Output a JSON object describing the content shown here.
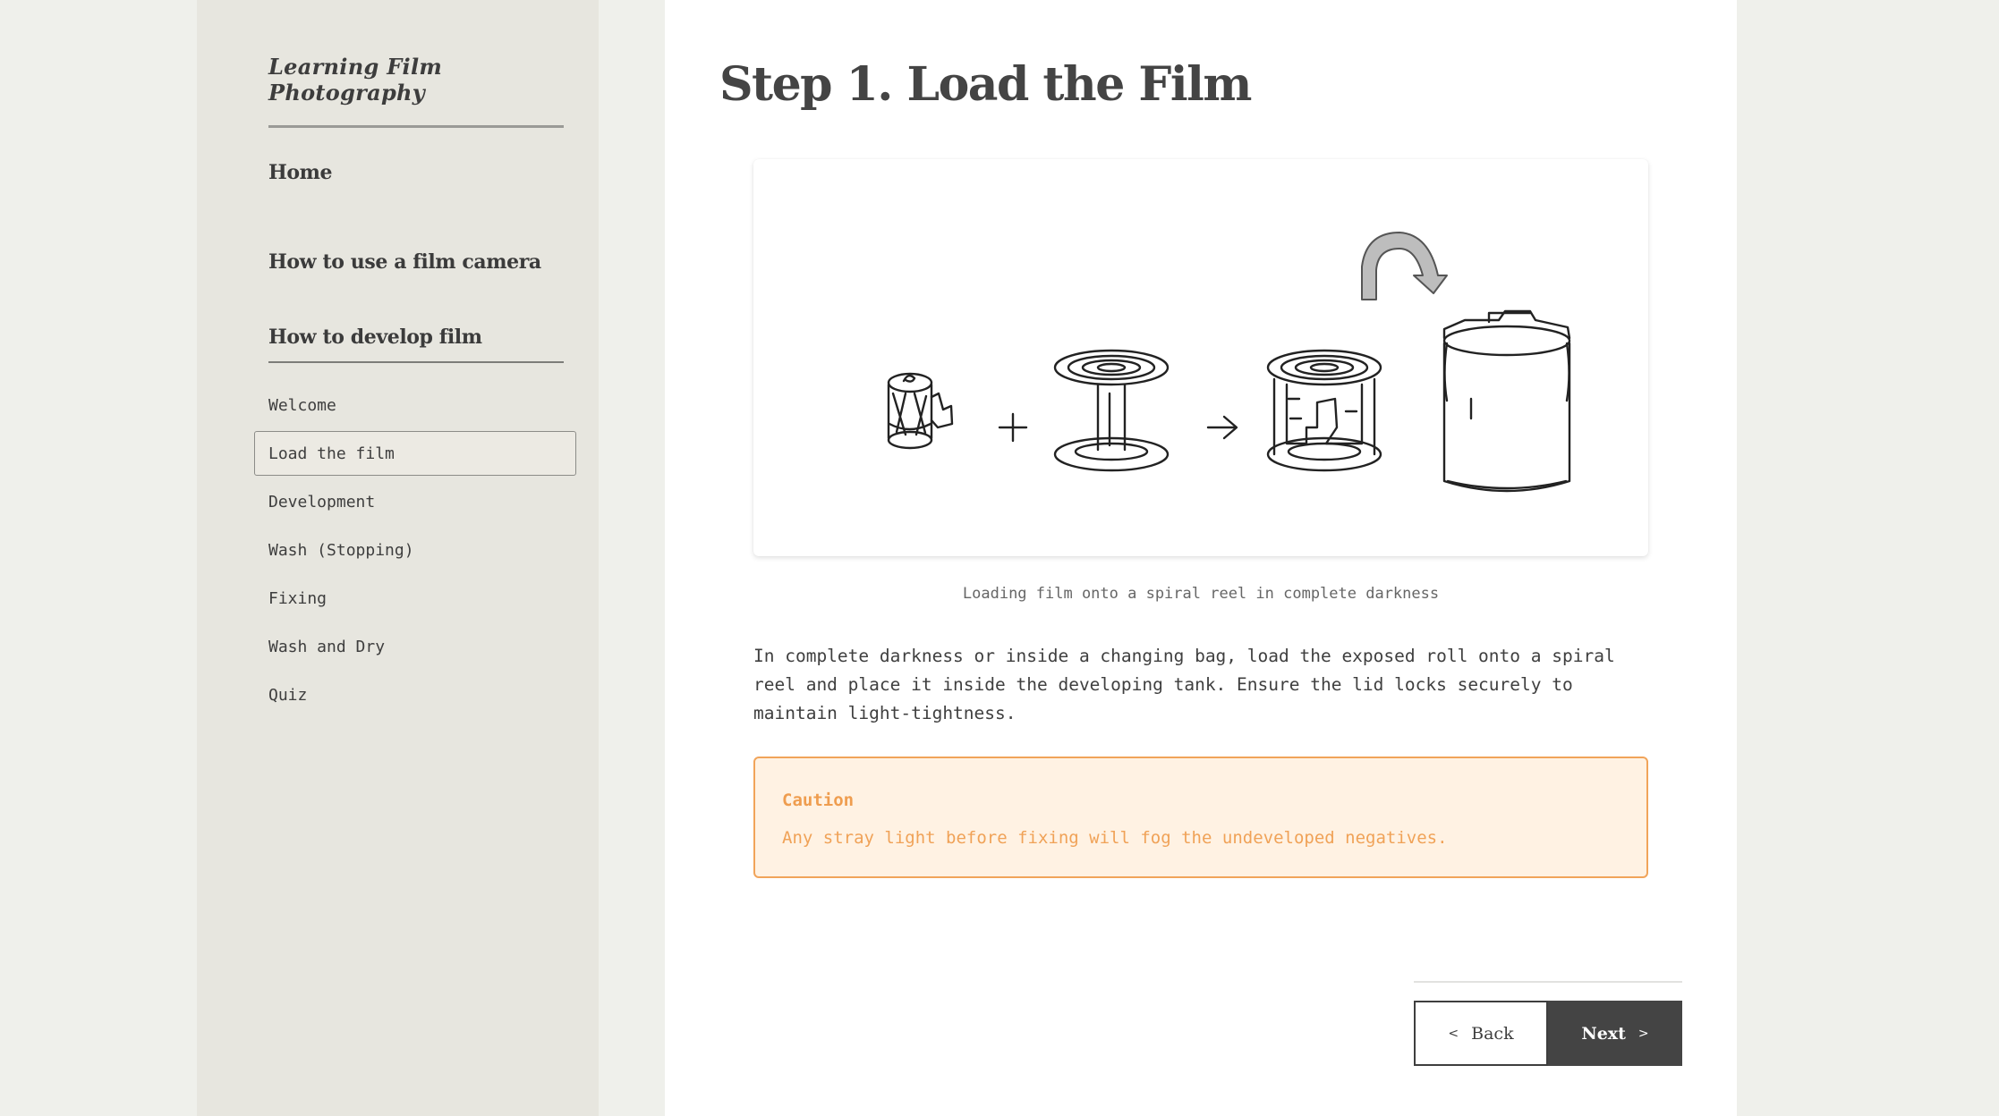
{
  "sidebar": {
    "site_title": "Learning Film Photography",
    "nav": {
      "home": "Home",
      "camera": "How to use a film camera",
      "develop": "How to develop film"
    },
    "sub_items": [
      {
        "label": "Welcome",
        "active": false
      },
      {
        "label": "Load the film",
        "active": true
      },
      {
        "label": "Development",
        "active": false
      },
      {
        "label": "Wash (Stopping)",
        "active": false
      },
      {
        "label": "Fixing",
        "active": false
      },
      {
        "label": "Wash and Dry",
        "active": false
      },
      {
        "label": "Quiz",
        "active": false
      }
    ]
  },
  "main": {
    "title": "Step 1. Load the Film",
    "figure": {
      "caption": "Loading film onto a spiral reel in complete darkness",
      "icons": [
        "film-canister-icon",
        "plus-icon",
        "spiral-reel-icon",
        "arrow-right-icon",
        "loaded-reel-icon",
        "curved-arrow-icon",
        "developing-tank-icon"
      ]
    },
    "body": "In complete darkness or inside a changing bag, load the exposed roll onto a spiral reel and place it inside the developing tank. Ensure the lid locks securely to maintain light-tightness.",
    "caution": {
      "title": "Caution",
      "text": "Any stray light before fixing will fog the undeveloped negatives."
    },
    "buttons": {
      "back_chevron": "<",
      "back": "Back",
      "next": "Next",
      "next_chevron": ">"
    }
  },
  "colors": {
    "page_bg": "#eff0eb",
    "sidebar_bg": "#e7e6df",
    "caution_bg": "#fff2e3",
    "caution_border": "#f1a45a",
    "caution_text": "#ef9d4f",
    "next_button_bg": "#444444"
  }
}
